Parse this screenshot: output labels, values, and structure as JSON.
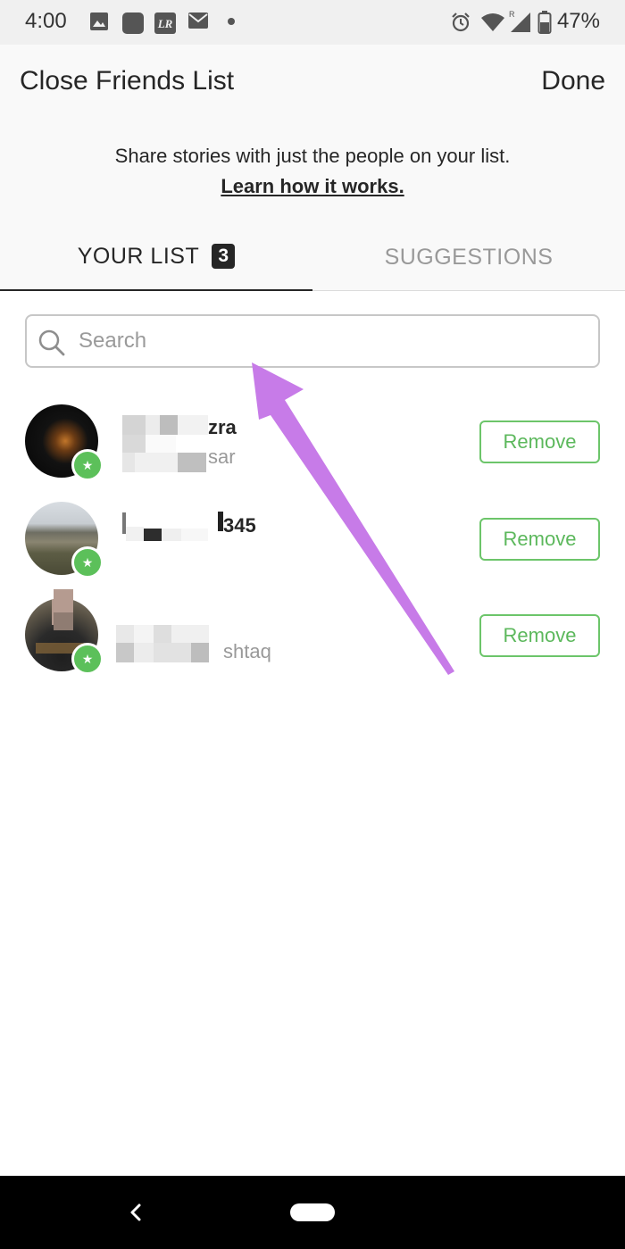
{
  "status_bar": {
    "time": "4:00",
    "battery": "47%",
    "icons": [
      "image-icon",
      "app-icon",
      "lightroom-icon",
      "mail-icon",
      "dot-icon",
      "alarm-icon",
      "wifi-icon",
      "signal-icon",
      "battery-icon"
    ]
  },
  "header": {
    "title": "Close Friends List",
    "done_label": "Done",
    "subtitle": "Share stories with just the people on your list.",
    "learn_link": "Learn how it works."
  },
  "tabs": [
    {
      "label": "YOUR LIST",
      "count": "3",
      "active": true
    },
    {
      "label": "SUGGESTIONS",
      "active": false
    }
  ],
  "search": {
    "placeholder": "Search",
    "value": ""
  },
  "friends": [
    {
      "username_visible": "zra",
      "fullname_visible": "sar",
      "remove_label": "Remove"
    },
    {
      "username_visible": "345",
      "fullname_visible": "",
      "remove_label": "Remove"
    },
    {
      "username_visible": "",
      "fullname_visible": "shtaq",
      "remove_label": "Remove"
    }
  ],
  "colors": {
    "accent_green": "#5cc05a",
    "annotation_arrow": "#c77be8",
    "text_primary": "#262626",
    "text_secondary": "#999999"
  }
}
